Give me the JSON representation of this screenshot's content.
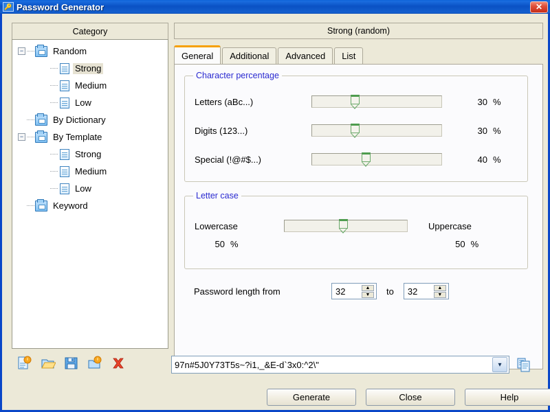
{
  "window": {
    "title": "Password Generator",
    "title_icon": "key-icon",
    "close_label": "✕"
  },
  "category": {
    "header": "Category",
    "tree": [
      {
        "label": "Random",
        "level": 0,
        "icon": "folder-icon",
        "expander": "−",
        "selected": false
      },
      {
        "label": "Strong",
        "level": 1,
        "icon": "document-icon",
        "expander": "",
        "selected": true
      },
      {
        "label": "Medium",
        "level": 1,
        "icon": "document-icon",
        "expander": "",
        "selected": false
      },
      {
        "label": "Low",
        "level": 1,
        "icon": "document-icon",
        "expander": "",
        "selected": false
      },
      {
        "label": "By Dictionary",
        "level": 0,
        "icon": "folder-icon",
        "expander": "",
        "selected": false
      },
      {
        "label": "By Template",
        "level": 0,
        "icon": "folder-icon",
        "expander": "−",
        "selected": false
      },
      {
        "label": "Strong",
        "level": 1,
        "icon": "document-icon",
        "expander": "",
        "selected": false
      },
      {
        "label": "Medium",
        "level": 1,
        "icon": "document-icon",
        "expander": "",
        "selected": false
      },
      {
        "label": "Low",
        "level": 1,
        "icon": "document-icon",
        "expander": "",
        "selected": false
      },
      {
        "label": "Keyword",
        "level": 0,
        "icon": "folder-icon",
        "expander": "",
        "selected": false
      }
    ]
  },
  "left_toolbar": [
    {
      "name": "new-document-icon"
    },
    {
      "name": "open-folder-icon"
    },
    {
      "name": "save-icon"
    },
    {
      "name": "new-folder-icon"
    },
    {
      "name": "delete-icon"
    }
  ],
  "right_pane": {
    "header": "Strong (random)",
    "tabs": [
      {
        "label": "General",
        "active": true
      },
      {
        "label": "Additional",
        "active": false
      },
      {
        "label": "Advanced",
        "active": false
      },
      {
        "label": "List",
        "active": false
      }
    ]
  },
  "character_percentage": {
    "title": "Character percentage",
    "rows": [
      {
        "label": "Letters (aBc...)",
        "value": 30,
        "unit": "%",
        "slider_pos_pct": 32
      },
      {
        "label": "Digits (123...)",
        "value": 30,
        "unit": "%",
        "slider_pos_pct": 32
      },
      {
        "label": "Special (!@#$...)",
        "value": 40,
        "unit": "%",
        "slider_pos_pct": 41
      }
    ]
  },
  "letter_case": {
    "title": "Letter case",
    "left_label": "Lowercase",
    "left_value": 50,
    "left_unit": "%",
    "right_label": "Uppercase",
    "right_value": 50,
    "right_unit": "%",
    "slider_pos_pct": 48
  },
  "password_length": {
    "label": "Password length from",
    "from_value": "32",
    "to_label": "to",
    "to_value": "32",
    "up_glyph": "▲",
    "down_glyph": "▼"
  },
  "password_output": {
    "value": "97n#5J0Y73T5s~?i1,_&E-d`3x0:^2\\\"",
    "dropdown_glyph": "▾",
    "copy_icon": "copy-icon"
  },
  "buttons": {
    "generate": "Generate",
    "close": "Close",
    "help": "Help"
  },
  "colors": {
    "titlebar_blue": "#0a51c4",
    "dialog_face": "#ece9d8",
    "group_label_blue": "#2a2ad0",
    "active_tab_accent": "#f6a000",
    "slider_green": "#6aa86a",
    "close_red": "#c62d18"
  }
}
